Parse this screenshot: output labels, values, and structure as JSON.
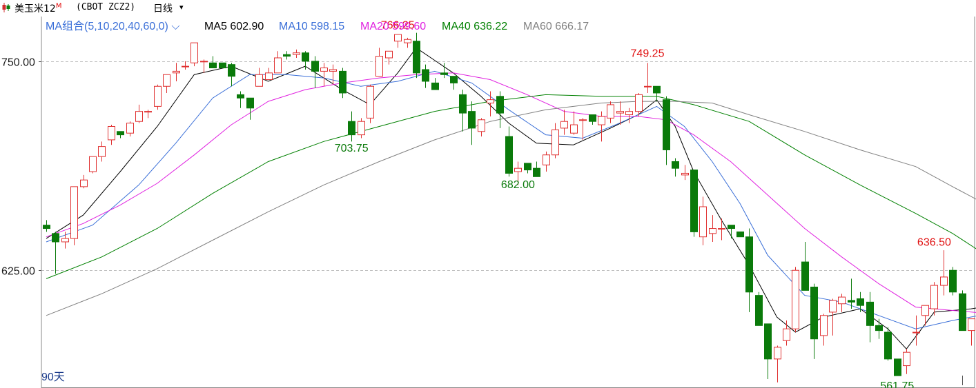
{
  "header": {
    "name": "美玉米12",
    "name_suffix": "M",
    "code": "(CBOT ZCZ2)",
    "period": "日线",
    "period_arrow": "▾"
  },
  "legend": {
    "group_label": "MA组合(5,10,20,40,60,0)",
    "group_arrow": "⌵",
    "items": [
      {
        "label": "MA5",
        "value": "602.90",
        "color": "#000000"
      },
      {
        "label": "MA10",
        "value": "598.15",
        "color": "#3a6fd8"
      },
      {
        "label": "MA20",
        "value": "599.60",
        "color": "#e020e0"
      },
      {
        "label": "MA40",
        "value": "636.22",
        "color": "#008000"
      },
      {
        "label": "MA60",
        "value": "666.17",
        "color": "#808080"
      }
    ]
  },
  "footer": {
    "days_label": "90天"
  },
  "colors": {
    "up": "#e03030",
    "down": "#0a7a0a",
    "grid": "#c0c0c0",
    "axis_text": "#1a1a1a"
  },
  "icons": {
    "logo": "candlestick-logo-icon"
  },
  "chart_data": {
    "type": "candlestick",
    "title": "美玉米12M (CBOT ZCZ2) 日线",
    "ylim": [
      560,
      773
    ],
    "y_ticks": [
      {
        "value": 750,
        "label": "750.00"
      },
      {
        "value": 625,
        "label": "625.00"
      }
    ],
    "candles": [
      [
        652,
        655,
        648,
        650
      ],
      [
        647,
        648,
        623,
        642
      ],
      [
        642,
        648,
        638,
        644
      ],
      [
        644,
        675,
        640,
        675
      ],
      [
        675,
        682,
        674,
        679
      ],
      [
        684,
        692,
        683,
        693
      ],
      [
        693,
        702,
        690,
        699
      ],
      [
        703,
        712,
        700,
        711
      ],
      [
        708,
        708,
        704,
        706
      ],
      [
        707,
        714,
        705,
        713
      ],
      [
        714,
        724,
        713,
        720
      ],
      [
        720,
        721,
        716,
        720
      ],
      [
        723,
        736,
        721,
        735
      ],
      [
        735,
        742,
        731,
        742
      ],
      [
        743,
        749,
        738,
        744
      ],
      [
        747,
        750,
        745,
        747
      ],
      [
        749,
        760,
        747,
        761
      ],
      [
        750,
        751,
        743,
        750
      ],
      [
        749,
        753,
        746,
        746
      ],
      [
        749,
        749,
        746,
        746
      ],
      [
        748,
        749,
        735,
        741
      ],
      [
        730,
        732,
        722,
        728
      ],
      [
        728,
        728,
        715,
        722
      ],
      [
        735,
        746,
        736,
        742
      ],
      [
        739,
        746,
        739,
        743
      ],
      [
        743,
        756,
        743,
        752
      ],
      [
        754,
        756,
        751,
        753
      ],
      [
        754,
        757,
        752,
        755
      ],
      [
        755,
        756,
        745,
        750
      ],
      [
        750,
        753,
        734,
        744
      ],
      [
        744,
        749,
        735,
        746
      ],
      [
        744,
        748,
        736,
        745
      ],
      [
        744,
        746,
        728,
        731
      ],
      [
        714,
        720,
        702,
        706
      ],
      [
        706,
        716,
        704,
        714
      ],
      [
        716,
        736,
        713,
        735
      ],
      [
        741,
        758,
        741,
        753
      ],
      [
        752,
        756,
        748,
        756
      ],
      [
        762,
        766,
        758,
        766
      ],
      [
        761,
        764,
        758,
        763
      ],
      [
        762,
        767,
        740,
        743
      ],
      [
        745,
        748,
        734,
        738
      ],
      [
        737,
        740,
        733,
        733
      ],
      [
        743,
        749,
        740,
        742
      ],
      [
        741,
        741,
        733,
        737
      ],
      [
        730,
        733,
        708,
        719
      ],
      [
        720,
        726,
        700,
        710
      ],
      [
        708,
        716,
        705,
        715
      ],
      [
        725,
        732,
        717,
        727
      ],
      [
        729,
        732,
        710,
        719
      ],
      [
        705,
        711,
        681,
        683
      ],
      [
        684,
        690,
        676,
        686
      ],
      [
        689,
        688,
        683,
        685
      ],
      [
        686,
        690,
        683,
        681
      ],
      [
        688,
        696,
        684,
        694
      ],
      [
        694,
        713,
        692,
        709
      ],
      [
        710,
        721,
        706,
        714
      ],
      [
        707,
        720,
        706,
        712
      ],
      [
        715,
        716,
        703,
        715
      ],
      [
        718,
        718,
        712,
        714
      ],
      [
        712,
        720,
        702,
        717
      ],
      [
        716,
        726,
        713,
        724
      ],
      [
        719,
        726,
        712,
        720
      ],
      [
        718,
        722,
        713,
        720
      ],
      [
        720,
        731,
        717,
        730
      ],
      [
        735,
        749,
        731,
        735
      ],
      [
        735,
        735,
        726,
        731
      ],
      [
        727,
        729,
        688,
        697
      ],
      [
        690,
        692,
        681,
        686
      ],
      [
        682,
        688,
        679,
        683
      ],
      [
        685,
        684,
        645,
        648
      ],
      [
        645,
        669,
        640,
        663
      ],
      [
        647,
        658,
        642,
        650
      ],
      [
        650,
        656,
        643,
        650
      ],
      [
        652,
        652,
        644,
        650
      ],
      [
        648,
        648,
        645,
        645
      ],
      [
        645,
        650,
        600,
        612
      ],
      [
        610,
        612,
        600,
        592
      ],
      [
        593,
        593,
        560,
        572
      ],
      [
        572,
        580,
        558,
        579
      ],
      [
        583,
        595,
        580,
        590
      ],
      [
        590,
        627,
        588,
        625
      ],
      [
        630,
        642,
        620,
        613
      ],
      [
        615,
        617,
        572,
        584
      ],
      [
        586,
        599,
        580,
        598
      ],
      [
        600,
        608,
        586,
        607
      ],
      [
        605,
        611,
        600,
        609
      ],
      [
        607,
        620,
        602,
        606
      ],
      [
        608,
        612,
        600,
        604
      ],
      [
        606,
        612,
        582,
        592
      ],
      [
        592,
        596,
        584,
        589
      ],
      [
        588,
        591,
        571,
        572
      ],
      [
        572,
        572,
        565,
        562
      ],
      [
        568,
        578,
        563,
        576
      ],
      [
        588,
        598,
        580,
        588
      ],
      [
        598,
        602,
        592,
        604
      ],
      [
        602,
        618,
        598,
        616
      ],
      [
        616,
        637,
        610,
        621
      ],
      [
        625,
        627,
        610,
        612
      ],
      [
        611,
        613,
        596,
        589
      ],
      [
        589,
        596,
        580,
        596
      ],
      [
        595,
        598,
        583,
        591
      ]
    ],
    "series": [
      {
        "name": "MA5",
        "color": "#000000",
        "points": [
          [
            0,
            644
          ],
          [
            4,
            658
          ],
          [
            8,
            684
          ],
          [
            12,
            711
          ],
          [
            16,
            742
          ],
          [
            20,
            747
          ],
          [
            24,
            738
          ],
          [
            28,
            747
          ],
          [
            32,
            733
          ],
          [
            35,
            724
          ],
          [
            38,
            743
          ],
          [
            40,
            758
          ],
          [
            44,
            743
          ],
          [
            47,
            729
          ],
          [
            50,
            713
          ],
          [
            53,
            701
          ],
          [
            57,
            700
          ],
          [
            61,
            710
          ],
          [
            64,
            718
          ],
          [
            66,
            727
          ],
          [
            68,
            711
          ],
          [
            70,
            684
          ],
          [
            73,
            655
          ],
          [
            76,
            628
          ],
          [
            79,
            597
          ],
          [
            81,
            588
          ],
          [
            84,
            597
          ],
          [
            88,
            602
          ],
          [
            91,
            590
          ],
          [
            93,
            578
          ],
          [
            96,
            600
          ],
          [
            100,
            602
          ],
          [
            101,
            602.9
          ]
        ]
      },
      {
        "name": "MA10",
        "color": "#3a6fd8",
        "points": [
          [
            0,
            642
          ],
          [
            5,
            652
          ],
          [
            10,
            676
          ],
          [
            14,
            701
          ],
          [
            18,
            728
          ],
          [
            22,
            742
          ],
          [
            26,
            742
          ],
          [
            30,
            740
          ],
          [
            34,
            735
          ],
          [
            38,
            738
          ],
          [
            42,
            744
          ],
          [
            46,
            737
          ],
          [
            50,
            721
          ],
          [
            54,
            706
          ],
          [
            58,
            704
          ],
          [
            62,
            713
          ],
          [
            66,
            723
          ],
          [
            69,
            711
          ],
          [
            72,
            690
          ],
          [
            75,
            665
          ],
          [
            78,
            634
          ],
          [
            82,
            610
          ],
          [
            86,
            606
          ],
          [
            90,
            598
          ],
          [
            94,
            590
          ],
          [
            98,
            595
          ],
          [
            101,
            598.15
          ]
        ]
      },
      {
        "name": "MA20",
        "color": "#e020e0",
        "points": [
          [
            0,
            645
          ],
          [
            4,
            653
          ],
          [
            8,
            664
          ],
          [
            12,
            677
          ],
          [
            16,
            694
          ],
          [
            20,
            712
          ],
          [
            24,
            726
          ],
          [
            28,
            733
          ],
          [
            32,
            737
          ],
          [
            36,
            740
          ],
          [
            40,
            742
          ],
          [
            44,
            743
          ],
          [
            48,
            739
          ],
          [
            52,
            730
          ],
          [
            56,
            720
          ],
          [
            60,
            717
          ],
          [
            64,
            717
          ],
          [
            67,
            715
          ],
          [
            70,
            706
          ],
          [
            74,
            690
          ],
          [
            78,
            670
          ],
          [
            82,
            650
          ],
          [
            86,
            633
          ],
          [
            90,
            617
          ],
          [
            94,
            603
          ],
          [
            98,
            601
          ],
          [
            101,
            599.6
          ]
        ]
      },
      {
        "name": "MA40",
        "color": "#008000",
        "points": [
          [
            0,
            620
          ],
          [
            6,
            633
          ],
          [
            12,
            650
          ],
          [
            18,
            671
          ],
          [
            24,
            690
          ],
          [
            30,
            702
          ],
          [
            36,
            711
          ],
          [
            42,
            720
          ],
          [
            48,
            726
          ],
          [
            54,
            730
          ],
          [
            60,
            729
          ],
          [
            66,
            729
          ],
          [
            70,
            724
          ],
          [
            76,
            714
          ],
          [
            82,
            694
          ],
          [
            88,
            676
          ],
          [
            94,
            659
          ],
          [
            98,
            647
          ],
          [
            101,
            636.22
          ]
        ]
      },
      {
        "name": "MA60",
        "color": "#808080",
        "points": [
          [
            0,
            598
          ],
          [
            6,
            611
          ],
          [
            12,
            626
          ],
          [
            18,
            643
          ],
          [
            24,
            660
          ],
          [
            30,
            676
          ],
          [
            36,
            690
          ],
          [
            42,
            703
          ],
          [
            48,
            714
          ],
          [
            54,
            721
          ],
          [
            60,
            725
          ],
          [
            64,
            726
          ],
          [
            68,
            726
          ],
          [
            72,
            725
          ],
          [
            76,
            718
          ],
          [
            82,
            708
          ],
          [
            88,
            697
          ],
          [
            94,
            687
          ],
          [
            98,
            675
          ],
          [
            101,
            666.17
          ]
        ]
      }
    ],
    "annotations": [
      {
        "label": "766.25",
        "index": 38,
        "value": 766.25,
        "kind": "high"
      },
      {
        "label": "749.25",
        "index": 65,
        "value": 749.25,
        "kind": "high"
      },
      {
        "label": "703.75",
        "index": 33,
        "value": 703.75,
        "kind": "low"
      },
      {
        "label": "682.00",
        "index": 51,
        "value": 682.0,
        "kind": "low"
      },
      {
        "label": "636.50",
        "index": 96,
        "value": 636.5,
        "kind": "high"
      },
      {
        "label": "561.75",
        "index": 92,
        "value": 561.75,
        "kind": "low"
      }
    ]
  }
}
